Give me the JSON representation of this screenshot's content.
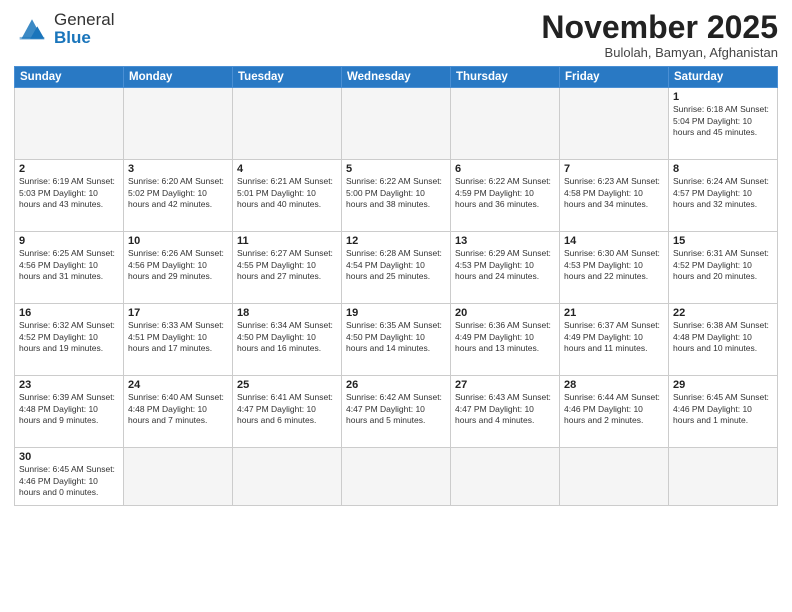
{
  "logo": {
    "text_general": "General",
    "text_blue": "Blue"
  },
  "header": {
    "month": "November 2025",
    "location": "Bulolah, Bamyan, Afghanistan"
  },
  "weekdays": [
    "Sunday",
    "Monday",
    "Tuesday",
    "Wednesday",
    "Thursday",
    "Friday",
    "Saturday"
  ],
  "weeks": [
    [
      {
        "day": "",
        "info": ""
      },
      {
        "day": "",
        "info": ""
      },
      {
        "day": "",
        "info": ""
      },
      {
        "day": "",
        "info": ""
      },
      {
        "day": "",
        "info": ""
      },
      {
        "day": "",
        "info": ""
      },
      {
        "day": "1",
        "info": "Sunrise: 6:18 AM\nSunset: 5:04 PM\nDaylight: 10 hours\nand 45 minutes."
      }
    ],
    [
      {
        "day": "2",
        "info": "Sunrise: 6:19 AM\nSunset: 5:03 PM\nDaylight: 10 hours\nand 43 minutes."
      },
      {
        "day": "3",
        "info": "Sunrise: 6:20 AM\nSunset: 5:02 PM\nDaylight: 10 hours\nand 42 minutes."
      },
      {
        "day": "4",
        "info": "Sunrise: 6:21 AM\nSunset: 5:01 PM\nDaylight: 10 hours\nand 40 minutes."
      },
      {
        "day": "5",
        "info": "Sunrise: 6:22 AM\nSunset: 5:00 PM\nDaylight: 10 hours\nand 38 minutes."
      },
      {
        "day": "6",
        "info": "Sunrise: 6:22 AM\nSunset: 4:59 PM\nDaylight: 10 hours\nand 36 minutes."
      },
      {
        "day": "7",
        "info": "Sunrise: 6:23 AM\nSunset: 4:58 PM\nDaylight: 10 hours\nand 34 minutes."
      },
      {
        "day": "8",
        "info": "Sunrise: 6:24 AM\nSunset: 4:57 PM\nDaylight: 10 hours\nand 32 minutes."
      }
    ],
    [
      {
        "day": "9",
        "info": "Sunrise: 6:25 AM\nSunset: 4:56 PM\nDaylight: 10 hours\nand 31 minutes."
      },
      {
        "day": "10",
        "info": "Sunrise: 6:26 AM\nSunset: 4:56 PM\nDaylight: 10 hours\nand 29 minutes."
      },
      {
        "day": "11",
        "info": "Sunrise: 6:27 AM\nSunset: 4:55 PM\nDaylight: 10 hours\nand 27 minutes."
      },
      {
        "day": "12",
        "info": "Sunrise: 6:28 AM\nSunset: 4:54 PM\nDaylight: 10 hours\nand 25 minutes."
      },
      {
        "day": "13",
        "info": "Sunrise: 6:29 AM\nSunset: 4:53 PM\nDaylight: 10 hours\nand 24 minutes."
      },
      {
        "day": "14",
        "info": "Sunrise: 6:30 AM\nSunset: 4:53 PM\nDaylight: 10 hours\nand 22 minutes."
      },
      {
        "day": "15",
        "info": "Sunrise: 6:31 AM\nSunset: 4:52 PM\nDaylight: 10 hours\nand 20 minutes."
      }
    ],
    [
      {
        "day": "16",
        "info": "Sunrise: 6:32 AM\nSunset: 4:52 PM\nDaylight: 10 hours\nand 19 minutes."
      },
      {
        "day": "17",
        "info": "Sunrise: 6:33 AM\nSunset: 4:51 PM\nDaylight: 10 hours\nand 17 minutes."
      },
      {
        "day": "18",
        "info": "Sunrise: 6:34 AM\nSunset: 4:50 PM\nDaylight: 10 hours\nand 16 minutes."
      },
      {
        "day": "19",
        "info": "Sunrise: 6:35 AM\nSunset: 4:50 PM\nDaylight: 10 hours\nand 14 minutes."
      },
      {
        "day": "20",
        "info": "Sunrise: 6:36 AM\nSunset: 4:49 PM\nDaylight: 10 hours\nand 13 minutes."
      },
      {
        "day": "21",
        "info": "Sunrise: 6:37 AM\nSunset: 4:49 PM\nDaylight: 10 hours\nand 11 minutes."
      },
      {
        "day": "22",
        "info": "Sunrise: 6:38 AM\nSunset: 4:48 PM\nDaylight: 10 hours\nand 10 minutes."
      }
    ],
    [
      {
        "day": "23",
        "info": "Sunrise: 6:39 AM\nSunset: 4:48 PM\nDaylight: 10 hours\nand 9 minutes."
      },
      {
        "day": "24",
        "info": "Sunrise: 6:40 AM\nSunset: 4:48 PM\nDaylight: 10 hours\nand 7 minutes."
      },
      {
        "day": "25",
        "info": "Sunrise: 6:41 AM\nSunset: 4:47 PM\nDaylight: 10 hours\nand 6 minutes."
      },
      {
        "day": "26",
        "info": "Sunrise: 6:42 AM\nSunset: 4:47 PM\nDaylight: 10 hours\nand 5 minutes."
      },
      {
        "day": "27",
        "info": "Sunrise: 6:43 AM\nSunset: 4:47 PM\nDaylight: 10 hours\nand 4 minutes."
      },
      {
        "day": "28",
        "info": "Sunrise: 6:44 AM\nSunset: 4:46 PM\nDaylight: 10 hours\nand 2 minutes."
      },
      {
        "day": "29",
        "info": "Sunrise: 6:45 AM\nSunset: 4:46 PM\nDaylight: 10 hours\nand 1 minute."
      }
    ],
    [
      {
        "day": "30",
        "info": "Sunrise: 6:45 AM\nSunset: 4:46 PM\nDaylight: 10 hours\nand 0 minutes."
      },
      {
        "day": "",
        "info": ""
      },
      {
        "day": "",
        "info": ""
      },
      {
        "day": "",
        "info": ""
      },
      {
        "day": "",
        "info": ""
      },
      {
        "day": "",
        "info": ""
      },
      {
        "day": "",
        "info": ""
      }
    ]
  ]
}
